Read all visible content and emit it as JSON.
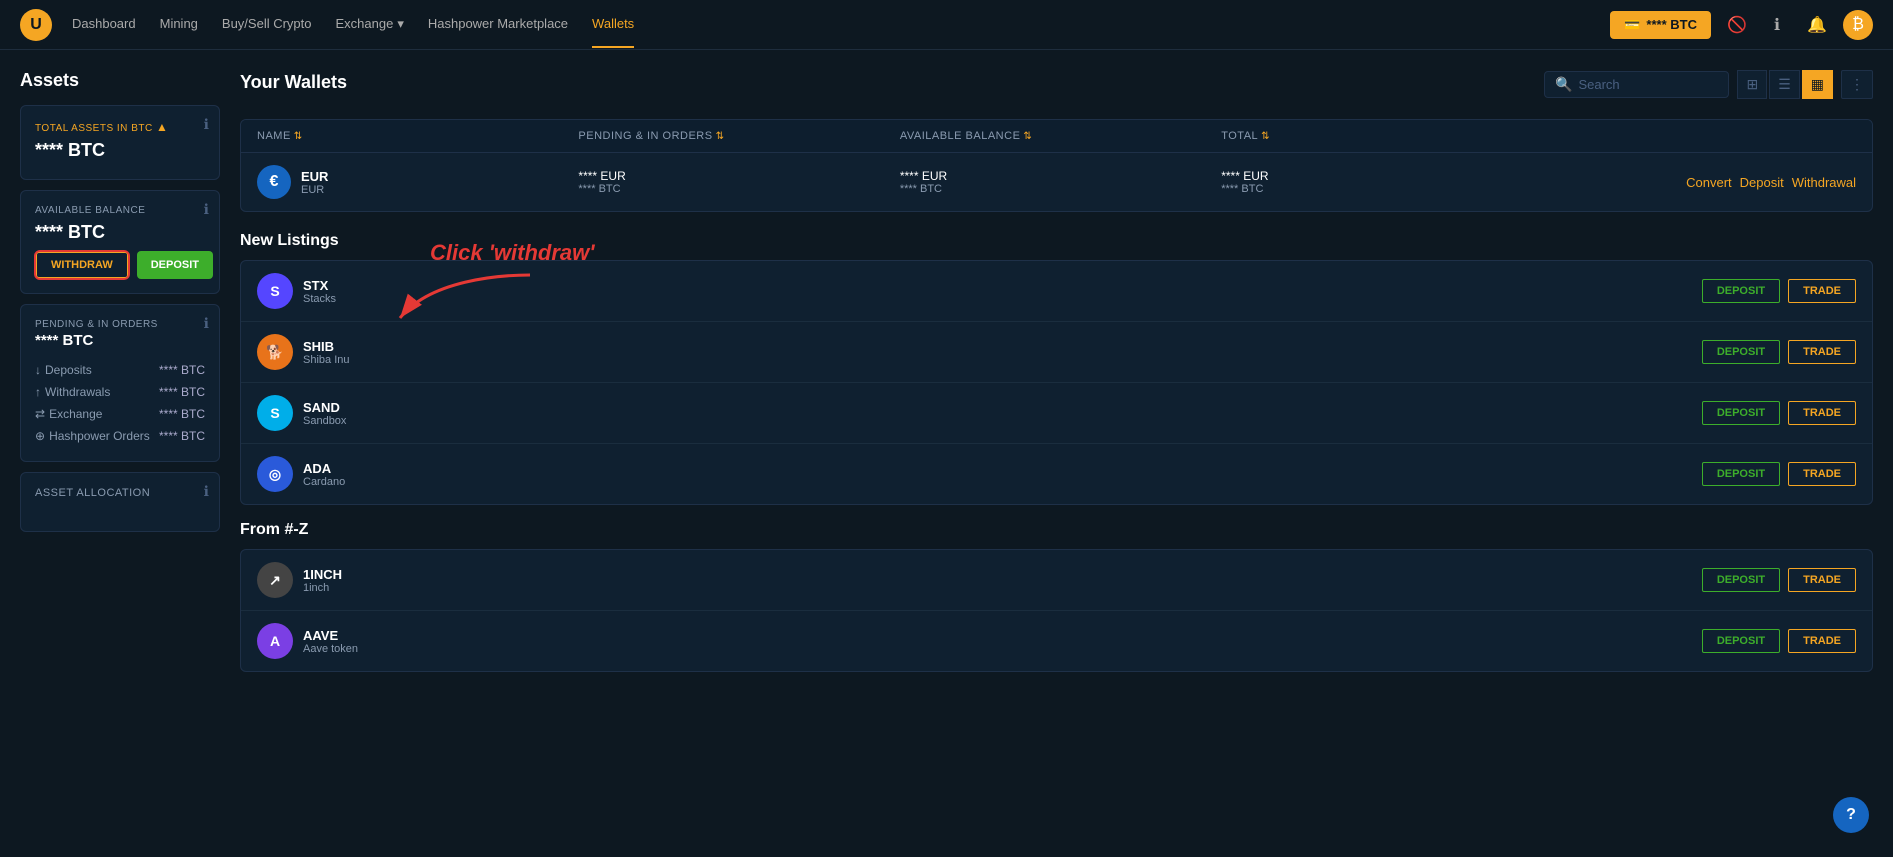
{
  "nav": {
    "logo": "U",
    "links": [
      {
        "label": "Dashboard",
        "active": false
      },
      {
        "label": "Mining",
        "active": false
      },
      {
        "label": "Buy/Sell Crypto",
        "active": false
      },
      {
        "label": "Exchange",
        "active": false,
        "has_dropdown": true
      },
      {
        "label": "Hashpower Marketplace",
        "active": false
      },
      {
        "label": "Wallets",
        "active": true
      }
    ],
    "btn_btc_label": "**** BTC",
    "icons": [
      "eye-slash-icon",
      "info-icon",
      "bell-icon"
    ],
    "avatar_icon": "₿"
  },
  "sidebar": {
    "title": "Assets",
    "total_assets": {
      "label": "TOTAL ASSETS IN",
      "currency_highlight": "BTC",
      "value": "**** BTC"
    },
    "available_balance": {
      "label": "AVAILABLE BALANCE",
      "value": "**** BTC",
      "btn_withdraw": "WITHDRAW",
      "btn_deposit": "DEPOSIT"
    },
    "pending": {
      "label": "PENDING & IN ORDERS",
      "value": "**** BTC",
      "items": [
        {
          "icon": "↓",
          "label": "Deposits",
          "value": "**** BTC"
        },
        {
          "icon": "↑",
          "label": "Withdrawals",
          "value": "**** BTC"
        },
        {
          "icon": "⇄",
          "label": "Exchange",
          "value": "**** BTC"
        },
        {
          "icon": "⊕",
          "label": "Hashpower Orders",
          "value": "**** BTC"
        }
      ]
    },
    "allocation": {
      "label": "ASSET ALLOCATION"
    }
  },
  "wallets": {
    "title": "Your Wallets",
    "search_placeholder": "Search",
    "columns": [
      {
        "key": "name",
        "label": "NAME"
      },
      {
        "key": "pending",
        "label": "PENDING & IN ORDERS"
      },
      {
        "key": "balance",
        "label": "AVAILABLE BALANCE"
      },
      {
        "key": "total",
        "label": "TOTAL"
      },
      {
        "key": "actions",
        "label": ""
      }
    ],
    "rows": [
      {
        "icon": "€",
        "icon_class": "eur",
        "name": "EUR",
        "subname": "EUR",
        "pending1": "**** EUR",
        "pending2": "**** BTC",
        "balance1": "**** EUR",
        "balance2": "**** BTC",
        "total1": "**** EUR",
        "total2": "**** BTC",
        "actions": [
          "Convert",
          "Deposit",
          "Withdrawal"
        ]
      }
    ],
    "view_grid": "⊞",
    "view_list": "☰",
    "view_active": "▦",
    "view_more": "⋮"
  },
  "new_listings": {
    "title": "New Listings",
    "items": [
      {
        "icon": "S",
        "icon_class": "stx",
        "name": "STX",
        "subname": "Stacks"
      },
      {
        "icon": "🐕",
        "icon_class": "shib",
        "name": "SHIB",
        "subname": "Shiba Inu"
      },
      {
        "icon": "S",
        "icon_class": "sand",
        "name": "SAND",
        "subname": "Sandbox"
      },
      {
        "icon": "◎",
        "icon_class": "ada",
        "name": "ADA",
        "subname": "Cardano"
      }
    ],
    "btn_deposit": "DEPOSIT",
    "btn_trade": "TRADE"
  },
  "from_az": {
    "title": "From #-Z",
    "items": [
      {
        "icon": "↗",
        "icon_class": "oneinch",
        "name": "1INCH",
        "subname": "1inch"
      },
      {
        "icon": "A",
        "icon_class": "aave",
        "name": "AAVE",
        "subname": "Aave token"
      }
    ],
    "btn_deposit": "DEPOSIT",
    "btn_trade": "TRADE"
  },
  "annotation": {
    "text": "Click 'withdraw'"
  },
  "help": {
    "label": "?"
  }
}
